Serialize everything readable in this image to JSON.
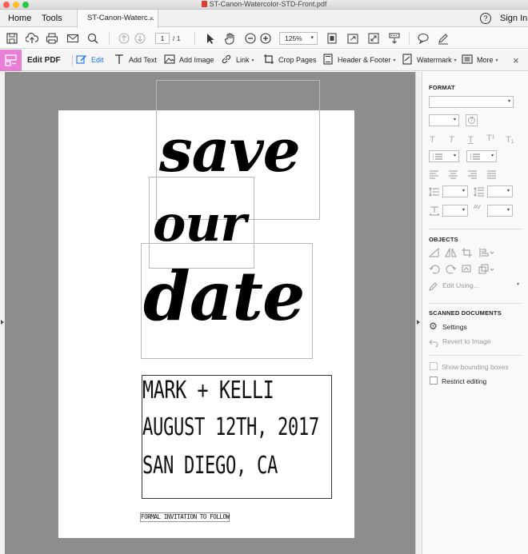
{
  "window": {
    "title": "ST-Canon-Watercolor-STD-Front.pdf"
  },
  "topnav": {
    "home": "Home",
    "tools": "Tools",
    "doc_tab": "ST-Canon-Waterc...",
    "tab_close": "×",
    "help": "?",
    "sign_in": "Sign In"
  },
  "toolbar": {
    "page_current": "1",
    "page_total": "/ 1",
    "zoom": "125%",
    "zoom_caret": "▾"
  },
  "editbar": {
    "title": "Edit PDF",
    "edit": "Edit",
    "add_text": "Add Text",
    "add_image": "Add Image",
    "link": "Link",
    "crop_pages": "Crop Pages",
    "header_footer": "Header & Footer",
    "watermark": "Watermark",
    "more": "More",
    "caret": "▾",
    "close": "×",
    "accent_color": "#e77fd6",
    "edit_color": "#1473e6"
  },
  "document": {
    "word1": "save",
    "word2": "our",
    "word3": "date",
    "line1": "MARK + KELLI",
    "line2": "AUGUST 12TH, 2017",
    "line3": "SAN DIEGO, CA",
    "footer": "FORMAL INVITATION TO FOLLOW"
  },
  "panel": {
    "format_title": "FORMAT",
    "glyph_t1": "T",
    "glyph_t2": "T",
    "glyph_t3": "T",
    "glyph_t4": "T¹",
    "glyph_t5": "T₁",
    "objects_title": "OBJECTS",
    "edit_using": "Edit Using...",
    "scanned_title": "SCANNED DOCUMENTS",
    "settings": "Settings",
    "revert": "Revert to Image",
    "show_bboxes": "Show bounding boxes",
    "restrict": "Restrict editing",
    "caret": "▾",
    "av_label": "AV"
  }
}
